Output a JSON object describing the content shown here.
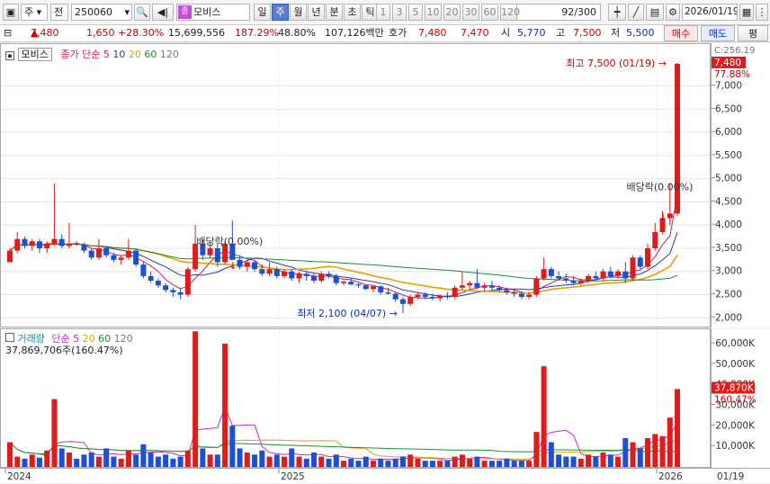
{
  "toolbar": {
    "market_select": "주",
    "price_type": "전",
    "stock_code": "250060",
    "stock_name": "모비스",
    "period_tabs": [
      {
        "label": "일",
        "active": false
      },
      {
        "label": "주",
        "active": true
      },
      {
        "label": "월",
        "active": false
      },
      {
        "label": "년",
        "active": false
      },
      {
        "label": "분",
        "active": false
      },
      {
        "label": "초",
        "active": false
      },
      {
        "label": "틱",
        "active": false
      }
    ],
    "intervals": [
      "1",
      "3",
      "5",
      "10",
      "20",
      "30",
      "60",
      "120"
    ],
    "count": "92/300",
    "date": "2026/01/19"
  },
  "quote": {
    "price": "7,480",
    "change": "1,650",
    "change_pct": "+28.30%",
    "volume": "15,699,556",
    "volume_ratio": "187.29%",
    "turnover": "48.80%",
    "amount": "107,126백만",
    "ask_label": "호가",
    "ask": "7,480",
    "bid": "7,470",
    "open_label": "시",
    "open": "5,770",
    "high_label": "고",
    "high": "7,500",
    "low_label": "저",
    "low": "5,500",
    "buy_button": "매수",
    "sell_button": "매도",
    "extra_button": "평"
  },
  "price_panel": {
    "name_label": "모비스",
    "ma_title": "종가 단순",
    "ma_periods": [
      "5",
      "10",
      "20",
      "60",
      "120"
    ],
    "ma_colors": [
      "#d81b60",
      "#1e3fbf",
      "#e6a100",
      "#1a8f3c",
      "#7a7a7a"
    ],
    "current_tag": "7,480",
    "current_pct_tag": "77.88%",
    "top_clip_text": "C:256.19",
    "axis_ticks": [
      "7,000",
      "6,500",
      "6,000",
      "5,500",
      "5,000",
      "4,500",
      "4,000",
      "3,500",
      "3,000",
      "2,500",
      "2,000"
    ],
    "annotations": {
      "high": "최고 7,500 (01/19)",
      "low": "최저 2,100 (04/07)",
      "dividend_1": "배당락(0.00%)",
      "dividend_2": "배당락(0.00%)"
    }
  },
  "volume_panel": {
    "title": "거래량",
    "ma_title": "단순",
    "ma_periods": [
      "5",
      "20",
      "60",
      "120"
    ],
    "summary": "37,869,706주(160.47%)",
    "current_tag": "37,870K",
    "current_pct_tag": "160.47%",
    "axis_ticks": [
      "60,000K",
      "50,000K",
      "40,000K",
      "30,000K",
      "20,000K",
      "10,000K"
    ]
  },
  "x_axis": {
    "labels": [
      "2024",
      "2025",
      "2026"
    ],
    "right_label": "01/19"
  },
  "chart_data": {
    "type": "candlestick",
    "period": "weekly",
    "y_range": [
      1850,
      7750
    ],
    "volume_range_k": [
      0,
      67000
    ],
    "candles": [
      [
        3200,
        3500,
        3300,
        3450,
        12000
      ],
      [
        3450,
        3850,
        3400,
        3700,
        5000
      ],
      [
        3700,
        3750,
        3500,
        3550,
        4000
      ],
      [
        3550,
        3700,
        3450,
        3650,
        6000
      ],
      [
        3650,
        3700,
        3400,
        3500,
        4500
      ],
      [
        3500,
        3650,
        3400,
        3600,
        8000
      ],
      [
        3600,
        4900,
        3550,
        3700,
        33000
      ],
      [
        3700,
        3800,
        3500,
        3550,
        9000
      ],
      [
        3550,
        4050,
        3500,
        3600,
        7000
      ],
      [
        3600,
        3650,
        3550,
        3580,
        4000
      ],
      [
        3580,
        3620,
        3400,
        3450,
        6000
      ],
      [
        3450,
        3500,
        3250,
        3300,
        7000
      ],
      [
        3300,
        3700,
        3250,
        3500,
        5000
      ],
      [
        3500,
        3550,
        3300,
        3350,
        9000
      ],
      [
        3350,
        3400,
        3200,
        3250,
        5000
      ],
      [
        3250,
        3350,
        3150,
        3300,
        4000
      ],
      [
        3300,
        3700,
        3250,
        3450,
        8000
      ],
      [
        3450,
        3500,
        3100,
        3150,
        6000
      ],
      [
        3150,
        3200,
        2850,
        2900,
        11000
      ],
      [
        2900,
        3000,
        2750,
        2800,
        7000
      ],
      [
        2800,
        2850,
        2650,
        2700,
        5000
      ],
      [
        2700,
        2750,
        2550,
        2600,
        6000
      ],
      [
        2600,
        2650,
        2450,
        2550,
        4000
      ],
      [
        2550,
        2650,
        2400,
        2500,
        5000
      ],
      [
        2500,
        3100,
        2450,
        3050,
        8000
      ],
      [
        3050,
        4000,
        3000,
        3600,
        66000
      ],
      [
        3600,
        3700,
        3250,
        3350,
        9000
      ],
      [
        3350,
        3650,
        3300,
        3500,
        6000
      ],
      [
        3500,
        3600,
        3100,
        3200,
        6000
      ],
      [
        3200,
        3650,
        3150,
        3600,
        60000
      ],
      [
        3600,
        4100,
        3550,
        3250,
        20000
      ],
      [
        3250,
        3350,
        3050,
        3100,
        9000
      ],
      [
        3100,
        3250,
        3000,
        3200,
        7000
      ],
      [
        3200,
        3250,
        3000,
        3050,
        6000
      ],
      [
        3050,
        3150,
        2900,
        2950,
        8000
      ],
      [
        2950,
        3200,
        2900,
        3050,
        5000
      ],
      [
        3050,
        3100,
        2850,
        2900,
        6000
      ],
      [
        2900,
        3050,
        2850,
        3000,
        5000
      ],
      [
        3000,
        3050,
        2800,
        2850,
        9000
      ],
      [
        2850,
        3000,
        2750,
        2950,
        5000
      ],
      [
        2950,
        3000,
        2800,
        2900,
        4000
      ],
      [
        2900,
        2950,
        2750,
        2800,
        7000
      ],
      [
        2800,
        3000,
        2750,
        2950,
        5000
      ],
      [
        2950,
        3000,
        2850,
        2900,
        4000
      ],
      [
        2900,
        2950,
        2700,
        2750,
        6000
      ],
      [
        2750,
        2800,
        2700,
        2780,
        3000
      ],
      [
        2780,
        2850,
        2700,
        2720,
        4000
      ],
      [
        2720,
        2750,
        2650,
        2700,
        3000
      ],
      [
        2700,
        2720,
        2600,
        2620,
        5000
      ],
      [
        2620,
        2700,
        2550,
        2680,
        3000
      ],
      [
        2680,
        2700,
        2500,
        2550,
        4000
      ],
      [
        2550,
        2650,
        2500,
        2520,
        3000
      ],
      [
        2520,
        2550,
        2350,
        2400,
        4000
      ],
      [
        2400,
        2450,
        2100,
        2300,
        5000
      ],
      [
        2300,
        2500,
        2250,
        2450,
        6000
      ],
      [
        2450,
        2550,
        2400,
        2500,
        4000
      ],
      [
        2500,
        2550,
        2400,
        2450,
        3000
      ],
      [
        2450,
        2520,
        2380,
        2420,
        3000
      ],
      [
        2420,
        2500,
        2350,
        2480,
        3000
      ],
      [
        2480,
        2550,
        2400,
        2450,
        3000
      ],
      [
        2450,
        2700,
        2400,
        2650,
        5000
      ],
      [
        2650,
        3000,
        2600,
        2700,
        6000
      ],
      [
        2700,
        2800,
        2600,
        2750,
        4000
      ],
      [
        2750,
        3050,
        2700,
        2650,
        5000
      ],
      [
        2650,
        2750,
        2550,
        2700,
        3000
      ],
      [
        2700,
        2800,
        2600,
        2650,
        3000
      ],
      [
        2650,
        2700,
        2550,
        2600,
        3000
      ],
      [
        2600,
        2650,
        2500,
        2550,
        4000
      ],
      [
        2550,
        2600,
        2450,
        2520,
        3000
      ],
      [
        2520,
        2560,
        2400,
        2450,
        3000
      ],
      [
        2450,
        2550,
        2400,
        2500,
        3000
      ],
      [
        2500,
        2900,
        2450,
        2850,
        17000
      ],
      [
        2850,
        3300,
        2800,
        3050,
        49000
      ],
      [
        3050,
        3100,
        2850,
        2900,
        12000
      ],
      [
        2900,
        3000,
        2800,
        2850,
        6000
      ],
      [
        2850,
        2950,
        2750,
        2800,
        5000
      ],
      [
        2800,
        2900,
        2700,
        2750,
        5000
      ],
      [
        2750,
        2850,
        2700,
        2800,
        4000
      ],
      [
        2800,
        2950,
        2750,
        2900,
        6000
      ],
      [
        2900,
        3000,
        2800,
        2850,
        5000
      ],
      [
        2850,
        3050,
        2800,
        3000,
        7000
      ],
      [
        3000,
        3100,
        2850,
        2900,
        6000
      ],
      [
        2900,
        3050,
        2850,
        3000,
        5000
      ],
      [
        3000,
        3200,
        2750,
        2850,
        14000
      ],
      [
        2850,
        3350,
        2800,
        3300,
        12000
      ],
      [
        3300,
        3350,
        3050,
        3100,
        9000
      ],
      [
        3100,
        3600,
        3050,
        3500,
        14000
      ],
      [
        3500,
        4050,
        3450,
        3850,
        16000
      ],
      [
        3850,
        4300,
        3800,
        4150,
        15000
      ],
      [
        4150,
        4900,
        4000,
        4250,
        24000
      ],
      [
        4250,
        7500,
        4200,
        7480,
        37870
      ]
    ]
  }
}
